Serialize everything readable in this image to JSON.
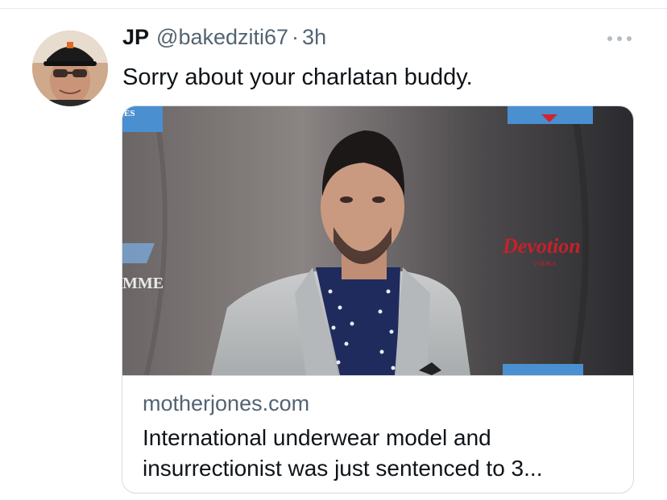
{
  "tweet": {
    "display_name": "JP",
    "handle": "@bakedziti67",
    "separator": "·",
    "time": "3h",
    "text": "Sorry about your charlatan buddy.",
    "avatar_icon": "user-avatar-photo",
    "more_icon": "more-horizontal-icon"
  },
  "card": {
    "image_signs": {
      "left_top": "ES",
      "left_mid": "MME",
      "right_logo": "Devotion",
      "right_sub": "VODKA"
    },
    "domain": "motherjones.com",
    "title_lines": [
      "International underwear model and",
      "insurrectionist was just sentenced to 3..."
    ]
  },
  "colors": {
    "text_primary": "#0f1419",
    "text_secondary": "#536471",
    "border": "#d6dbdf",
    "logo_red": "#c8202a"
  }
}
